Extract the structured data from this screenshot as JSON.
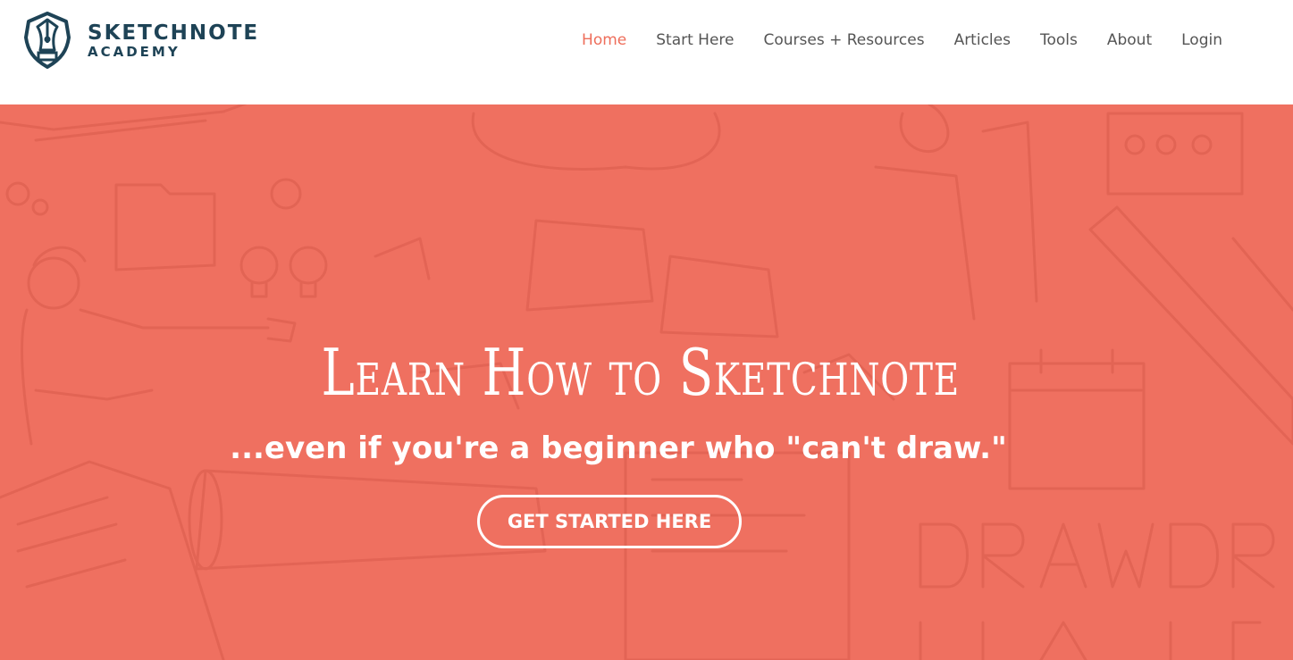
{
  "colors": {
    "brand_dark": "#1e4356",
    "accent": "#ee6e5b",
    "hero_bg": "#ef7060",
    "nav_text": "#555555"
  },
  "logo": {
    "icon": "pen-nib-shield-icon",
    "line1": "SKETCHNOTE",
    "line2": "ACADEMY"
  },
  "nav": {
    "items": [
      {
        "label": "Home",
        "active": true
      },
      {
        "label": "Start Here"
      },
      {
        "label": "Courses + Resources"
      },
      {
        "label": "Articles"
      },
      {
        "label": "Tools"
      },
      {
        "label": "About"
      },
      {
        "label": "Login"
      }
    ]
  },
  "hero": {
    "title": "Learn How to Sketchnote",
    "subtitle": "...even if you're a beginner who \"can't draw.\"",
    "cta_label": "GET STARTED HERE",
    "background": "sketchnote-doodles-illustration"
  }
}
